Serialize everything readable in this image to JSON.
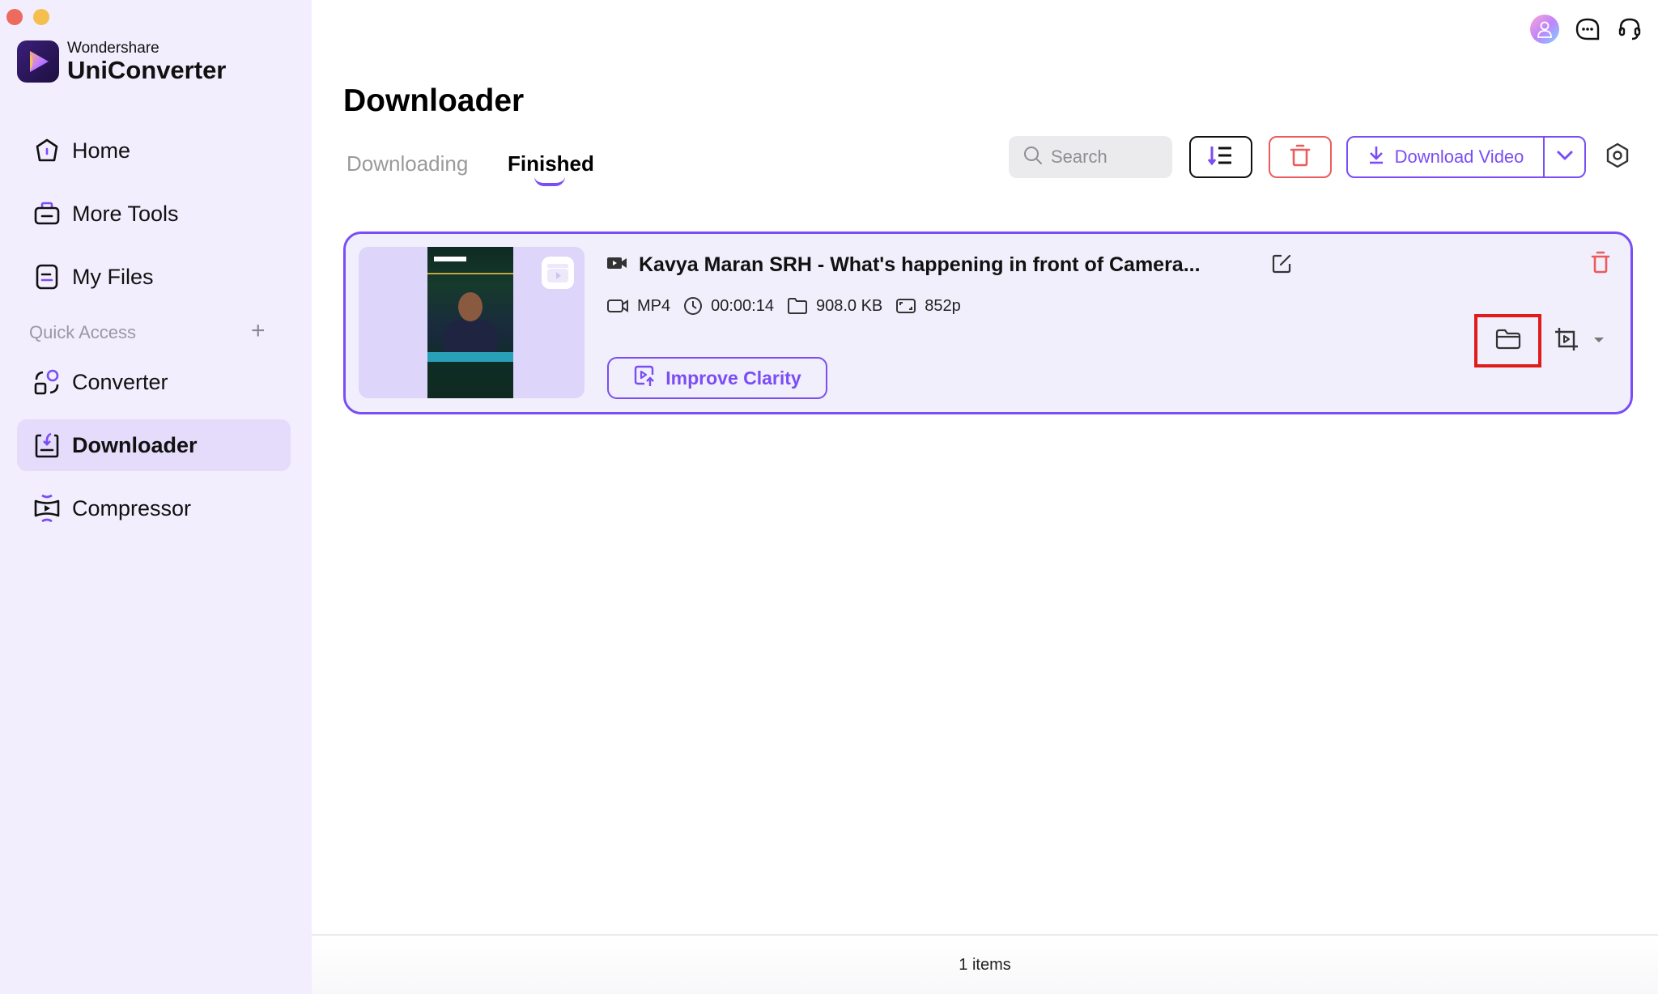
{
  "window": {
    "traffic_lights": [
      "close",
      "minimize"
    ]
  },
  "brand": {
    "company": "Wondershare",
    "product": "UniConverter"
  },
  "sidebar": {
    "items": [
      {
        "label": "Home",
        "icon": "home-icon"
      },
      {
        "label": "More Tools",
        "icon": "toolbox-icon"
      },
      {
        "label": "My Files",
        "icon": "files-icon"
      }
    ],
    "quick_access_title": "Quick Access",
    "quick_access_add": "+",
    "quick_items": [
      {
        "label": "Converter",
        "icon": "converter-icon"
      },
      {
        "label": "Downloader",
        "icon": "downloader-icon",
        "active": true
      },
      {
        "label": "Compressor",
        "icon": "compressor-icon"
      }
    ]
  },
  "header": {
    "title": "Downloader",
    "tabs": [
      {
        "label": "Downloading",
        "active": false
      },
      {
        "label": "Finished",
        "active": true
      }
    ],
    "search_placeholder": "Search",
    "download_button": "Download Video"
  },
  "downloads": [
    {
      "title": "Kavya Maran SRH - What's happening in front of Camera...",
      "format": "MP4",
      "duration": "00:00:14",
      "size": "908.0 KB",
      "resolution": "852p",
      "improve_label": "Improve Clarity"
    }
  ],
  "footer": {
    "count_text": "1 items"
  },
  "colors": {
    "accent": "#7a4df5",
    "danger": "#ec5b5b",
    "sidebar_bg": "#f2eefd",
    "active_item_bg": "#e5dbfb",
    "highlight_box": "#e01b1b"
  }
}
